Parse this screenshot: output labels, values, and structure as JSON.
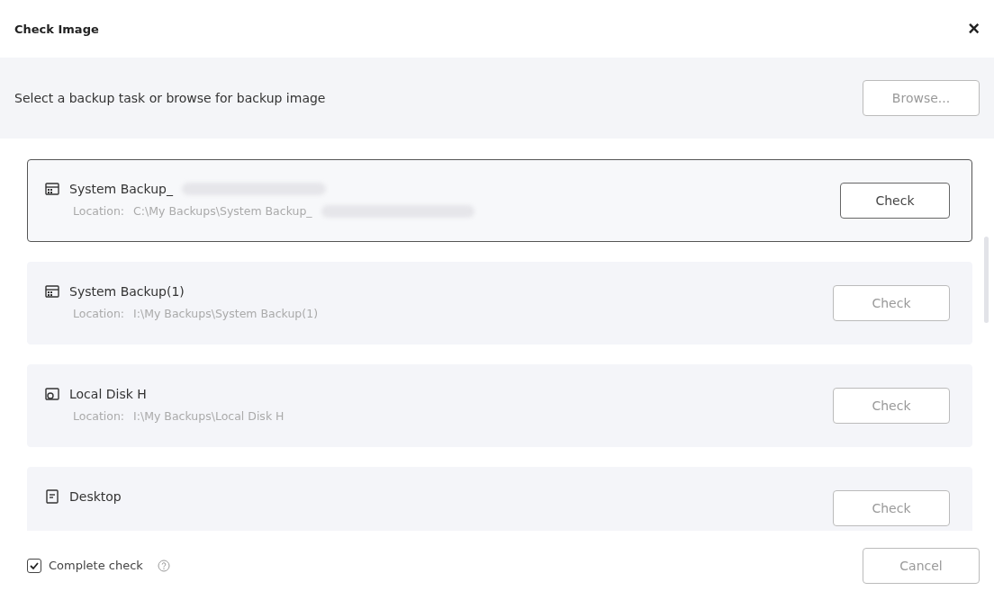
{
  "window": {
    "title": "Check Image",
    "close": "×"
  },
  "header": {
    "prompt": "Select a backup task or browse for backup image",
    "browse_button": "Browse..."
  },
  "tasks": [
    {
      "kind": "system",
      "name": "System Backup_",
      "location_label": "Location:",
      "location": "C:\\My Backups\\System Backup_",
      "redacted": true,
      "selected": true,
      "button": "Check"
    },
    {
      "kind": "system",
      "name": "System Backup(1)",
      "location_label": "Location:",
      "location": "I:\\My Backups\\System Backup(1)",
      "redacted": false,
      "selected": false,
      "button": "Check"
    },
    {
      "kind": "disk",
      "name": "Local Disk H",
      "location_label": "Location:",
      "location": "I:\\My Backups\\Local Disk H",
      "redacted": false,
      "selected": false,
      "button": "Check"
    },
    {
      "kind": "file",
      "name": "Desktop",
      "redacted": false,
      "selected": false,
      "button": "Check"
    }
  ],
  "footer": {
    "complete_check": {
      "label": "Complete check",
      "checked": true
    },
    "cancel_button": "Cancel"
  }
}
